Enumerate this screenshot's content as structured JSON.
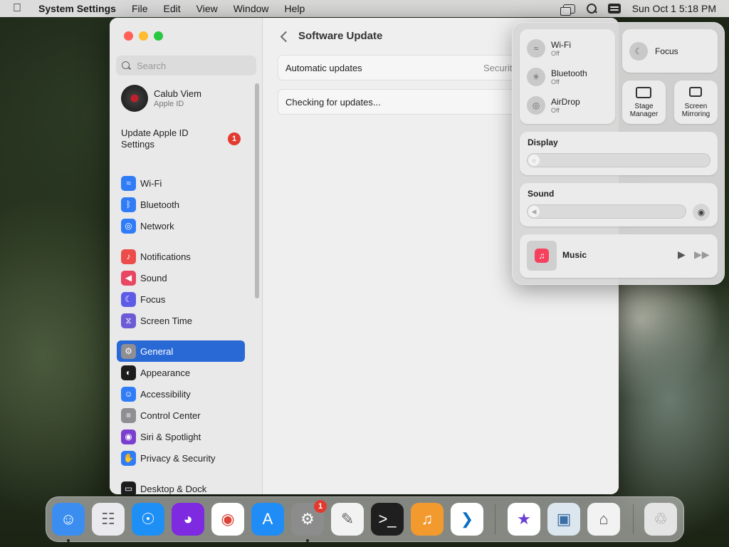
{
  "menubar": {
    "app_name": "System Settings",
    "menus": [
      "File",
      "Edit",
      "View",
      "Window",
      "Help"
    ],
    "clock": "Sun Oct 1  5:18 PM"
  },
  "sidebar": {
    "search_placeholder": "Search",
    "profile": {
      "name": "Calub Viem",
      "subtitle": "Apple ID"
    },
    "update_apple_id": {
      "label": "Update Apple ID Settings",
      "badge": "1"
    },
    "items": [
      {
        "label": "Wi-Fi",
        "icon": "wifi-icon",
        "color": "#2f7cf6"
      },
      {
        "label": "Bluetooth",
        "icon": "bluetooth-icon",
        "color": "#2f7cf6"
      },
      {
        "label": "Network",
        "icon": "globe-icon",
        "color": "#2f7cf6"
      },
      {
        "label": "Notifications",
        "icon": "bell-icon",
        "color": "#ec4d4a"
      },
      {
        "label": "Sound",
        "icon": "speaker-icon",
        "color": "#e94661"
      },
      {
        "label": "Focus",
        "icon": "moon-icon",
        "color": "#5e5ce6"
      },
      {
        "label": "Screen Time",
        "icon": "hourglass-icon",
        "color": "#6c5bd5"
      },
      {
        "label": "General",
        "icon": "gear-icon",
        "color": "#8e8e93",
        "active": true
      },
      {
        "label": "Appearance",
        "icon": "appearance-icon",
        "color": "#1c1c1e"
      },
      {
        "label": "Accessibility",
        "icon": "accessibility-icon",
        "color": "#2f7cf6"
      },
      {
        "label": "Control Center",
        "icon": "control-center-icon",
        "color": "#8e8e93"
      },
      {
        "label": "Siri & Spotlight",
        "icon": "siri-icon",
        "color": "#7b3fd0"
      },
      {
        "label": "Privacy & Security",
        "icon": "hand-icon",
        "color": "#2f7cf6"
      },
      {
        "label": "Desktop & Dock",
        "icon": "dock-icon",
        "color": "#1c1c1e"
      }
    ]
  },
  "main": {
    "title": "Software Update",
    "automatic_updates": {
      "label": "Automatic updates",
      "value": "Securit"
    },
    "status": "Checking for updates..."
  },
  "control_center": {
    "wifi": {
      "label": "Wi-Fi",
      "state": "Off"
    },
    "bluetooth": {
      "label": "Bluetooth",
      "state": "Off"
    },
    "airdrop": {
      "label": "AirDrop",
      "state": "Off"
    },
    "focus": "Focus",
    "stage_manager": "Stage Manager",
    "screen_mirroring": "Screen Mirroring",
    "display_label": "Display",
    "sound_label": "Sound",
    "music_label": "Music"
  },
  "dock": {
    "apps": [
      {
        "name": "finder",
        "color": "#3b8ef0"
      },
      {
        "name": "launchpad",
        "color": "#e9e9ee"
      },
      {
        "name": "safari",
        "color": "#1e8ff5"
      },
      {
        "name": "firefox",
        "color": "#7d2ae0"
      },
      {
        "name": "chrome",
        "color": "#ffffff"
      },
      {
        "name": "app-store",
        "color": "#1f8df5"
      },
      {
        "name": "system-settings",
        "color": "#8c8c8c",
        "badge": "1"
      },
      {
        "name": "textedit",
        "color": "#f2f2f2"
      },
      {
        "name": "terminal",
        "color": "#1f1f1f"
      },
      {
        "name": "garageband",
        "color": "#f29a2e"
      },
      {
        "name": "vscode",
        "color": "#ffffff"
      },
      {
        "name": "imovie",
        "color": "#ffffff"
      },
      {
        "name": "preview",
        "color": "#dbe6ef"
      },
      {
        "name": "archive-utility",
        "color": "#f2f2f2"
      },
      {
        "name": "trash",
        "color": "#e4e4e4"
      }
    ]
  }
}
